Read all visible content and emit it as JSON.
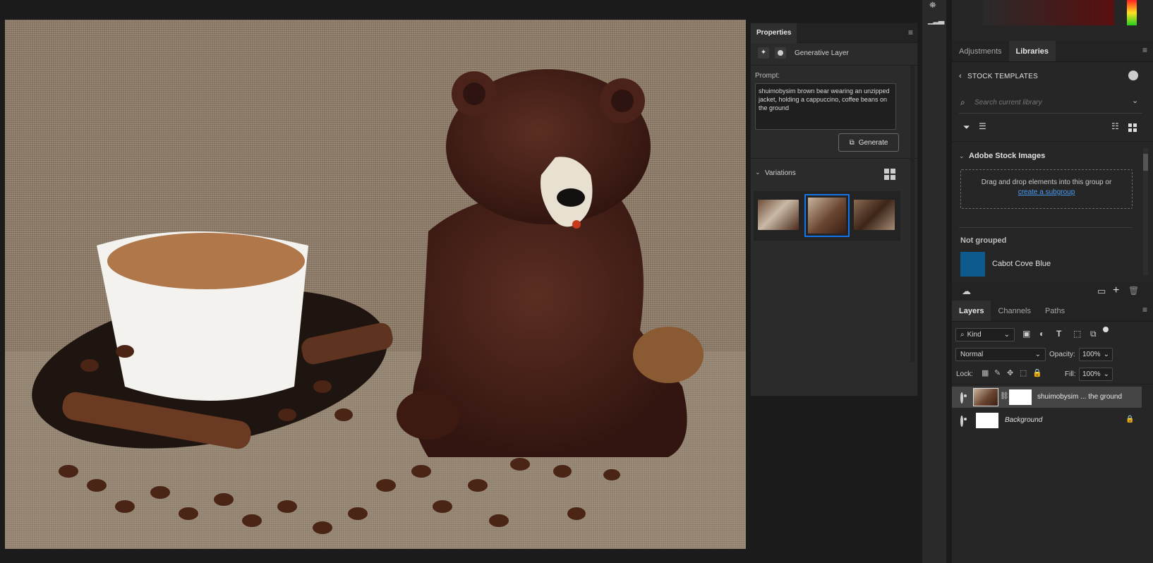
{
  "properties": {
    "tab_label": "Properties",
    "layer_type": "Generative Layer",
    "prompt_label": "Prompt:",
    "prompt_value": "shuimobysim brown bear wearing an unzipped jacket, holding a cappuccino, coffee beans on the ground",
    "generate_label": "Generate",
    "variations_label": "Variations",
    "variations": [
      {
        "name": "variation-1",
        "selected": false
      },
      {
        "name": "variation-2",
        "selected": true
      },
      {
        "name": "variation-3",
        "selected": false
      }
    ]
  },
  "libraries": {
    "tabs": [
      {
        "label": "Adjustments",
        "active": false
      },
      {
        "label": "Libraries",
        "active": true
      }
    ],
    "breadcrumb": "STOCK TEMPLATES",
    "search_placeholder": "Search current library",
    "group_title": "Adobe Stock Images",
    "dropzone_text": "Drag and drop elements into this group or",
    "dropzone_link": "create a subgroup",
    "not_grouped_label": "Not grouped",
    "swatch_name": "Cabot Cove Blue",
    "swatch_color": "#0f5a8c"
  },
  "layers": {
    "tabs": [
      {
        "label": "Layers",
        "active": true
      },
      {
        "label": "Channels",
        "active": false
      },
      {
        "label": "Paths",
        "active": false
      }
    ],
    "filter_label": "Kind",
    "blend_mode": "Normal",
    "opacity_label": "Opacity:",
    "opacity_value": "100%",
    "lock_label": "Lock:",
    "fill_label": "Fill:",
    "fill_value": "100%",
    "items": [
      {
        "name": "shuimobysim ... the ground",
        "italic": false,
        "selected": true,
        "locked": false
      },
      {
        "name": "Background",
        "italic": true,
        "selected": false,
        "locked": true
      }
    ]
  },
  "colors": {
    "accent": "#1473e6",
    "link": "#4b9cf5",
    "selected_layer_bg": "#454545"
  }
}
